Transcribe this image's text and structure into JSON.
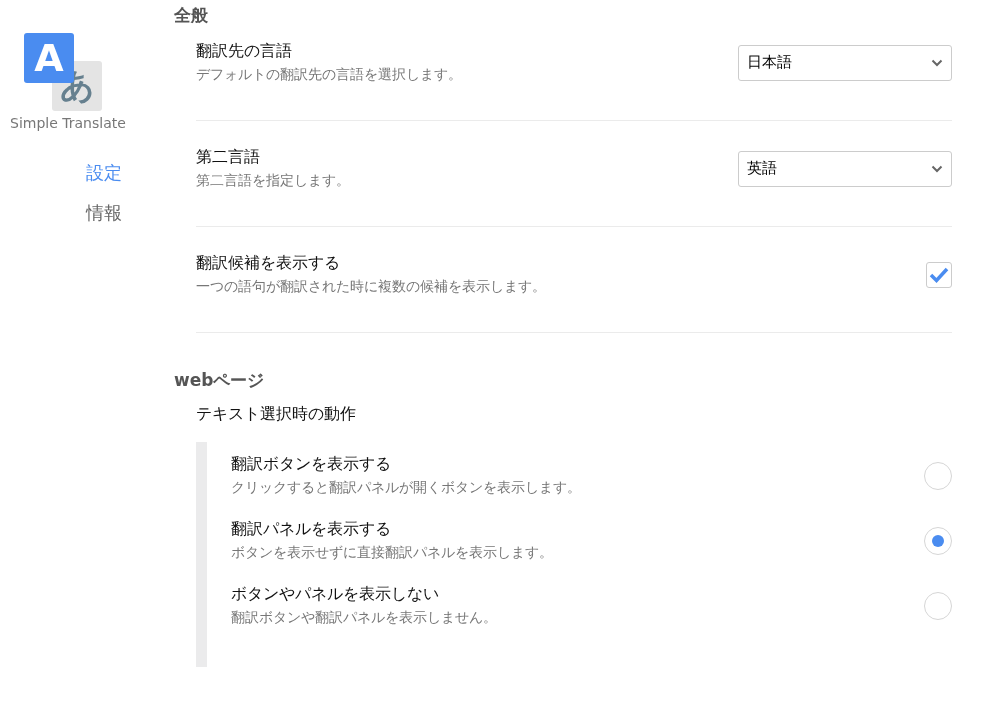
{
  "logo": {
    "latin": "A",
    "kana": "あ"
  },
  "app_name": "Simple Translate",
  "nav": [
    {
      "label": "設定",
      "selected": true
    },
    {
      "label": "情報",
      "selected": false
    }
  ],
  "sections": [
    {
      "title": "全般",
      "rows": [
        {
          "kind": "select",
          "title": "翻訳先の言語",
          "description": "デフォルトの翻訳先の言語を選択します。",
          "value": "日本語"
        },
        {
          "kind": "select",
          "title": "第二言語",
          "description": "第二言語を指定します。",
          "value": "英語"
        },
        {
          "kind": "checkbox",
          "title": "翻訳候補を表示する",
          "description": "一つの語句が翻訳された時に複数の候補を表示します。",
          "checked": true
        }
      ]
    },
    {
      "title": "webページ",
      "rows": [
        {
          "kind": "radio-group",
          "title": "テキスト選択時の動作",
          "options": [
            {
              "title": "翻訳ボタンを表示する",
              "description": "クリックすると翻訳パネルが開くボタンを表示します。",
              "selected": false
            },
            {
              "title": "翻訳パネルを表示する",
              "description": "ボタンを表示せずに直接翻訳パネルを表示します。",
              "selected": true
            },
            {
              "title": "ボタンやパネルを表示しない",
              "description": "翻訳ボタンや翻訳パネルを表示しません。",
              "selected": false
            }
          ]
        }
      ]
    }
  ]
}
